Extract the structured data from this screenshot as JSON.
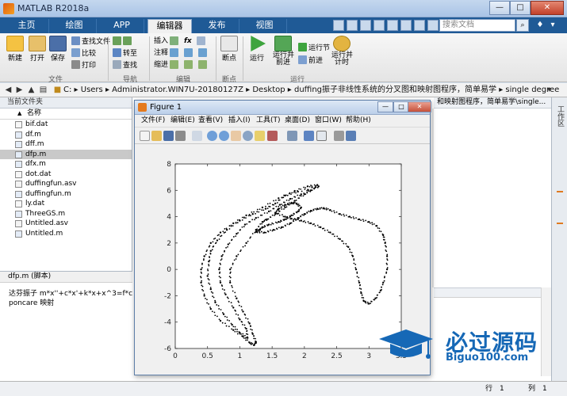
{
  "app": {
    "title": "MATLAB R2018a"
  },
  "window_controls": {
    "minimize": "—",
    "maximize": "□",
    "close": "✕"
  },
  "tabs": [
    "主页",
    "绘图",
    "APP",
    "编辑器",
    "发布",
    "视图"
  ],
  "search": {
    "placeholder": "搜索文档"
  },
  "ribbon": {
    "new": "新建",
    "open": "打开",
    "save": "保存",
    "find_files": "查找文件",
    "compare": "比较",
    "print": "打印",
    "goto": "转至",
    "find": "查找",
    "insert": "插入",
    "comment": "注释",
    "indent": "缩进",
    "fx": "fx",
    "breakpoints": "断点",
    "run": "运行",
    "run_advance": "运行并\n前进",
    "run_section": "运行节",
    "advance": "前进",
    "run_time": "运行并\n计时",
    "group_file": "文件",
    "group_nav": "导航",
    "group_edit": "编辑",
    "group_bp": "断点",
    "group_run": "运行"
  },
  "path": {
    "segments": [
      "C:",
      "Users",
      "Administrator.WIN7U-20180127Z",
      "Desktop",
      "duffing振子非线性系统的分叉图和映射图程序，简单易学",
      "single degree"
    ]
  },
  "current_folder": {
    "title": "当前文件夹",
    "column": "名称",
    "files": [
      {
        "name": "bif.dat",
        "type": "dat"
      },
      {
        "name": "df.m",
        "type": "m"
      },
      {
        "name": "dff.m",
        "type": "m"
      },
      {
        "name": "dfp.m",
        "type": "m"
      },
      {
        "name": "dfx.m",
        "type": "m"
      },
      {
        "name": "dot.dat",
        "type": "dat"
      },
      {
        "name": "duffingfun.asv",
        "type": "asv"
      },
      {
        "name": "duffingfun.m",
        "type": "m"
      },
      {
        "name": "ly.dat",
        "type": "dat"
      },
      {
        "name": "ThreeGS.m",
        "type": "m"
      },
      {
        "name": "Untitled.asv",
        "type": "asv"
      },
      {
        "name": "Untitled.m",
        "type": "m"
      }
    ],
    "selected": "dfp.m"
  },
  "details": {
    "title": "dfp.m  (脚本)",
    "lines": [
      "达芬振子 m*x''+c*x'+k*x+x^3=f*cos(w*t)",
      "poncare 映射"
    ]
  },
  "editor_tab": "和映射图程序，简单易学\\single...",
  "right_panel": {
    "label": "工作区"
  },
  "status": {
    "label_row": "行",
    "row": "1",
    "label_col": "列",
    "col": "1"
  },
  "figure": {
    "title": "Figure 1",
    "menus": [
      "文件(F)",
      "编辑(E)",
      "查看(V)",
      "插入(I)",
      "工具(T)",
      "桌面(D)",
      "窗口(W)",
      "帮助(H)"
    ]
  },
  "chart_data": {
    "type": "scatter",
    "title": "",
    "xlabel": "",
    "ylabel": "",
    "xlim": [
      0,
      3.5
    ],
    "ylim": [
      -6,
      8
    ],
    "xticks": [
      0,
      0.5,
      1,
      1.5,
      2,
      2.5,
      3,
      3.5
    ],
    "yticks": [
      -6,
      -4,
      -2,
      0,
      2,
      4,
      6,
      8
    ],
    "marker": "dot",
    "color": "#000000",
    "note": "Poincaré map attractor (Duffing oscillator)",
    "series": [
      {
        "points": [
          [
            2.2,
            6.4
          ],
          [
            2.05,
            6.3
          ],
          [
            1.85,
            5.95
          ],
          [
            1.6,
            5.4
          ],
          [
            1.35,
            4.7
          ],
          [
            1.1,
            4.1
          ],
          [
            0.9,
            3.5
          ],
          [
            0.7,
            2.8
          ],
          [
            0.55,
            2.0
          ],
          [
            0.45,
            1.0
          ],
          [
            0.4,
            0.0
          ],
          [
            0.4,
            -1.0
          ],
          [
            0.45,
            -2.0
          ],
          [
            0.55,
            -3.0
          ],
          [
            0.7,
            -3.9
          ],
          [
            0.9,
            -4.6
          ],
          [
            1.05,
            -5.1
          ],
          [
            1.15,
            -5.55
          ],
          [
            1.22,
            -5.75
          ],
          [
            1.25,
            -5.5
          ],
          [
            1.2,
            -4.9
          ],
          [
            1.15,
            -4.1
          ],
          [
            1.05,
            -3.2
          ],
          [
            0.95,
            -2.2
          ],
          [
            0.85,
            -1.0
          ],
          [
            0.85,
            0.0
          ],
          [
            0.95,
            1.0
          ],
          [
            1.1,
            2.0
          ],
          [
            1.25,
            3.0
          ],
          [
            1.35,
            3.6
          ],
          [
            1.42,
            3.8
          ],
          [
            1.55,
            4.2
          ],
          [
            1.7,
            4.7
          ],
          [
            1.85,
            5.2
          ],
          [
            2.0,
            5.7
          ],
          [
            2.1,
            6.0
          ],
          [
            2.22,
            6.3
          ],
          [
            1.9,
            5.9
          ],
          [
            1.7,
            5.6
          ],
          [
            1.55,
            5.0
          ],
          [
            1.4,
            4.6
          ],
          [
            1.2,
            4.2
          ],
          [
            1.0,
            3.7
          ],
          [
            0.8,
            3.0
          ],
          [
            0.65,
            2.2
          ],
          [
            0.55,
            1.4
          ],
          [
            0.52,
            0.6
          ],
          [
            0.5,
            -0.5
          ],
          [
            0.55,
            -1.5
          ],
          [
            0.62,
            -2.5
          ],
          [
            0.75,
            -3.4
          ],
          [
            0.88,
            -4.2
          ],
          [
            1.0,
            -4.8
          ],
          [
            1.12,
            -5.2
          ],
          [
            1.1,
            -4.5
          ],
          [
            1.0,
            -3.8
          ],
          [
            0.9,
            -2.9
          ],
          [
            0.78,
            -1.9
          ],
          [
            0.7,
            -1.0
          ],
          [
            0.68,
            0.0
          ],
          [
            0.72,
            1.0
          ],
          [
            0.82,
            1.9
          ],
          [
            0.95,
            2.7
          ],
          [
            1.08,
            3.4
          ],
          [
            1.25,
            3.9
          ],
          [
            1.45,
            4.4
          ],
          [
            1.62,
            4.9
          ],
          [
            1.78,
            5.35
          ],
          [
            1.95,
            5.7
          ]
        ]
      },
      {
        "points": [
          [
            1.55,
            4.3
          ],
          [
            1.6,
            4.6
          ],
          [
            1.7,
            4.9
          ],
          [
            1.8,
            5.05
          ],
          [
            1.88,
            5.0
          ],
          [
            1.95,
            4.7
          ],
          [
            1.9,
            4.4
          ],
          [
            1.8,
            4.1
          ],
          [
            1.7,
            3.8
          ],
          [
            1.6,
            3.6
          ],
          [
            1.45,
            3.4
          ],
          [
            1.35,
            3.2
          ],
          [
            1.3,
            3.0
          ],
          [
            1.25,
            2.85
          ],
          [
            1.38,
            2.8
          ],
          [
            1.52,
            3.0
          ],
          [
            1.65,
            3.2
          ],
          [
            1.78,
            3.5
          ],
          [
            1.9,
            3.9
          ],
          [
            2.0,
            4.2
          ],
          [
            2.1,
            4.45
          ],
          [
            2.2,
            4.6
          ],
          [
            2.3,
            4.65
          ],
          [
            2.4,
            4.5
          ],
          [
            2.55,
            4.2
          ],
          [
            2.7,
            4.0
          ],
          [
            2.85,
            3.8
          ],
          [
            3.0,
            3.6
          ],
          [
            3.12,
            3.3
          ],
          [
            3.22,
            2.6
          ],
          [
            3.25,
            2.0
          ],
          [
            3.28,
            1.0
          ],
          [
            3.28,
            0.0
          ],
          [
            3.22,
            -1.0
          ],
          [
            3.18,
            -1.6
          ],
          [
            3.1,
            -2.2
          ],
          [
            3.0,
            -2.6
          ],
          [
            2.92,
            -2.4
          ],
          [
            2.88,
            -1.8
          ],
          [
            2.85,
            -1.0
          ],
          [
            2.8,
            0.0
          ],
          [
            2.75,
            1.0
          ],
          [
            2.68,
            1.7
          ],
          [
            2.55,
            2.3
          ],
          [
            2.4,
            2.8
          ],
          [
            2.25,
            3.2
          ],
          [
            2.1,
            3.5
          ],
          [
            1.95,
            3.7
          ],
          [
            1.8,
            3.85
          ],
          [
            1.7,
            4.0
          ]
        ]
      }
    ]
  },
  "watermark": {
    "title": "必过源码",
    "url": "Biguo100.com"
  }
}
